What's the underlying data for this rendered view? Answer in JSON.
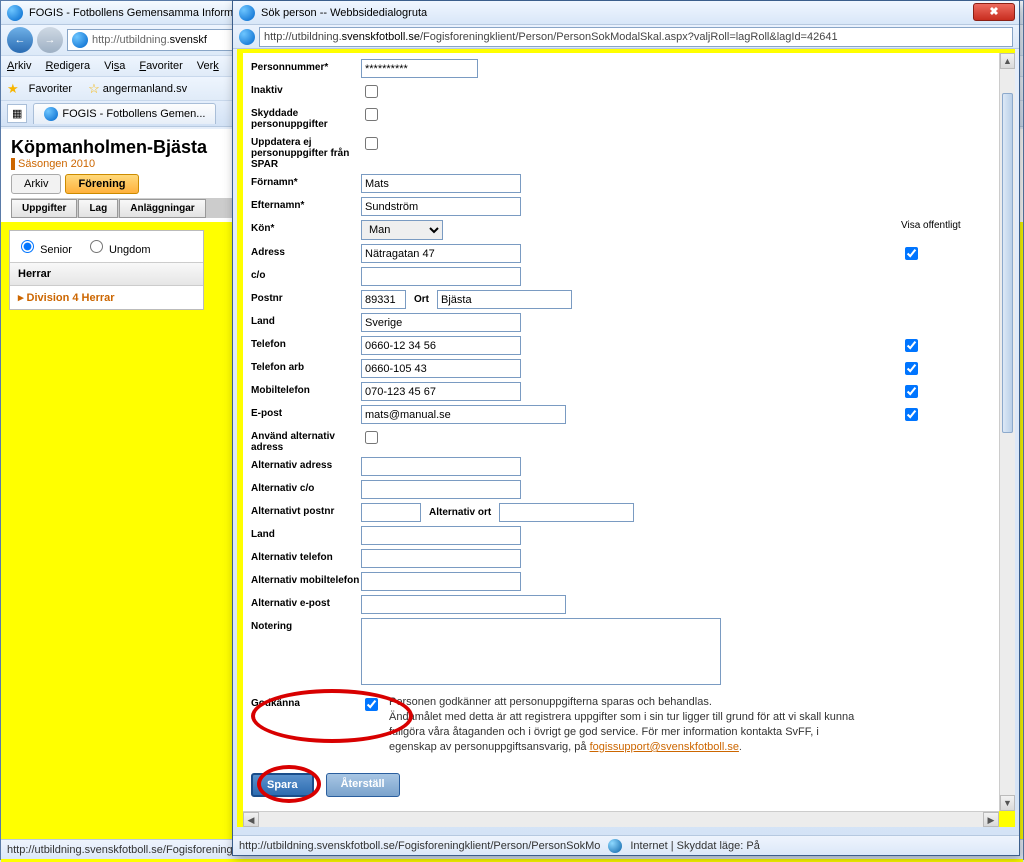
{
  "main_window": {
    "title": "FOGIS - Fotbollens Gemensamma Informa",
    "url_prefix": "http://utbildning.",
    "url_domain": "svenskf",
    "menus": [
      "Arkiv",
      "Redigera",
      "Visa",
      "Favoriter",
      "Verk"
    ],
    "favorites_label": "Favoriter",
    "fav_site": "angermanland.sv",
    "tab_label": "FOGIS - Fotbollens Gemen...",
    "page_heading": "Köpmanholmen-Bjästa",
    "season": "Säsongen 2010",
    "main_tabs": {
      "arkiv": "Arkiv",
      "forening": "Förening"
    },
    "sub_tabs": {
      "uppgifter": "Uppgifter",
      "lag": "Lag",
      "anlaggningar": "Anläggningar"
    },
    "panel": {
      "senior": "Senior",
      "ungdom": "Ungdom",
      "header": "Herrar",
      "item": "Division 4 Herrar"
    },
    "status_url": "http://utbildning.svenskfotboll.se/Fogisforeningklient/Lag/LagPersoner.aspx?lagId=42641&sparaflik=1&valieiflik=1#"
  },
  "dialog": {
    "title": "Sök person -- Webbsidedialogruta",
    "url_prefix": "http://utbildning.",
    "url_domain": "svenskfotboll.se",
    "url_path": "/Fogisforeningklient/Person/PersonSokModalSkal.aspx?valjRoll=lagRoll&lagId=42641",
    "status_url": "http://utbildning.svenskfotboll.se/Fogisforeningklient/Person/PersonSokMo",
    "status_zone": "Internet | Skyddat läge: På"
  },
  "form": {
    "visa_offentligt": "Visa offentligt",
    "labels": {
      "personnummer": "Personnummer*",
      "inaktiv": "Inaktiv",
      "skyddade": "Skyddade personuppgifter",
      "uppdatera": "Uppdatera ej personuppgifter från SPAR",
      "fornamn": "Förnamn*",
      "efternamn": "Efternamn*",
      "kon": "Kön*",
      "adress": "Adress",
      "co": "c/o",
      "postnr": "Postnr",
      "ort": "Ort",
      "land": "Land",
      "telefon": "Telefon",
      "telefon_arb": "Telefon arb",
      "mobil": "Mobiltelefon",
      "epost": "E-post",
      "anvand_alt": "Använd alternativ adress",
      "alt_adress": "Alternativ adress",
      "alt_co": "Alternativ c/o",
      "alt_postnr": "Alternativt postnr",
      "alt_ort": "Alternativ ort",
      "alt_land": "Land",
      "alt_telefon": "Alternativ telefon",
      "alt_mobil": "Alternativ mobiltelefon",
      "alt_epost": "Alternativ e-post",
      "notering": "Notering",
      "godkanna": "Godkänna"
    },
    "values": {
      "personnummer": "**********",
      "fornamn": "Mats",
      "efternamn": "Sundström",
      "kon": "Man",
      "adress": "Nätragatan 47",
      "co": "",
      "postnr": "89331",
      "ort": "Bjästa",
      "land": "Sverige",
      "telefon": "0660-12 34 56",
      "telefon_arb": "0660-105 43",
      "mobil": "070-123 45 67",
      "epost": "mats@manual.se",
      "alt_adress": "",
      "alt_co": "",
      "alt_postnr": "",
      "alt_ort": "",
      "alt_land": "",
      "alt_telefon": "",
      "alt_mobil": "",
      "alt_epost": "",
      "notering": ""
    },
    "consent_text1": "Personen godkänner att personuppgifterna sparas och behandlas.",
    "consent_text2": "Ändamålet med detta är att registrera uppgifter som i sin tur ligger till grund för att vi skall kunna fullgöra våra åtaganden och i övrigt ge god service. För mer information kontakta SvFF, i egenskap av personuppgiftsansvarig, på ",
    "consent_email": "fogissupport@svenskfotboll.se",
    "save_btn": "Spara",
    "reset_btn": "Återställ"
  }
}
